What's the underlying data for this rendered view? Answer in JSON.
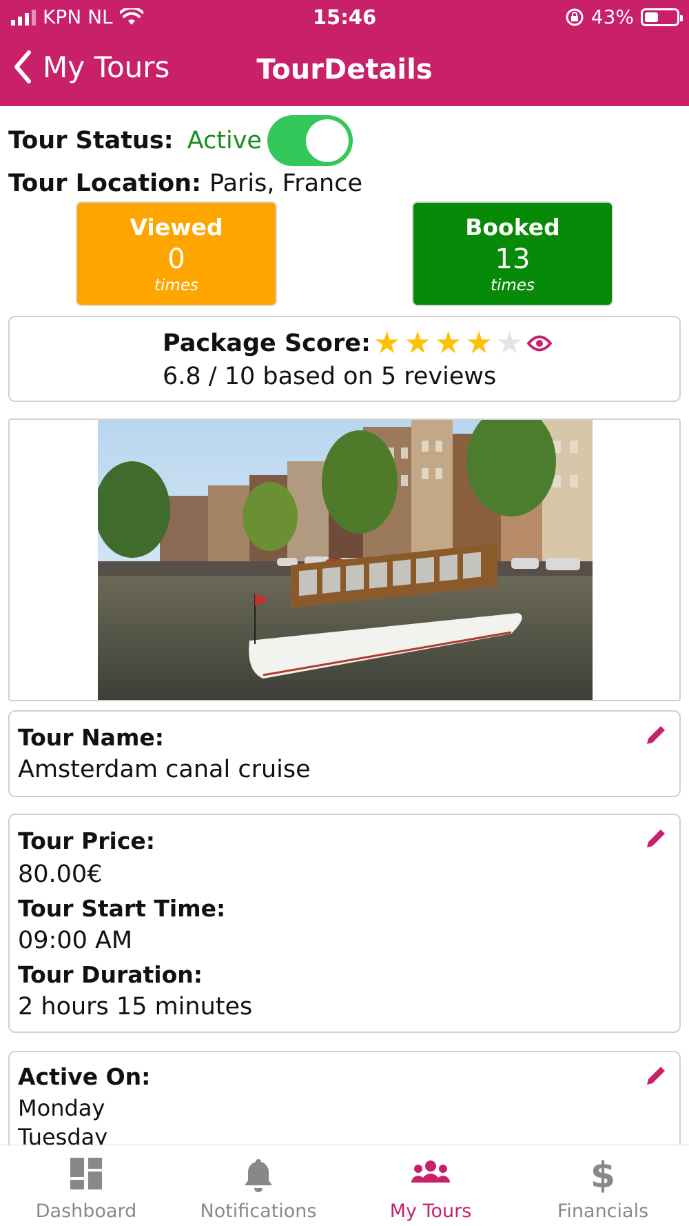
{
  "status_bar": {
    "carrier": "KPN NL",
    "time": "15:46",
    "battery": "43%",
    "battery_level": 0.43
  },
  "nav": {
    "back_label": "My Tours",
    "title": "TourDetails"
  },
  "tour_status": {
    "label": "Tour Status:",
    "value": "Active",
    "enabled": true
  },
  "tour_location": {
    "label": "Tour Location:",
    "value": "Paris, France"
  },
  "stats": {
    "viewed": {
      "title": "Viewed",
      "count": "0",
      "unit": "times",
      "color": "#ffa500"
    },
    "booked": {
      "title": "Booked",
      "count": "13",
      "unit": "times",
      "color": "#078a07"
    }
  },
  "package_score": {
    "label": "Package Score:",
    "stars_filled": 4,
    "stars_total": 5,
    "summary": "6.8 / 10 based on 5 reviews"
  },
  "tour_image": {
    "description_icon": "canal-boat-photo"
  },
  "tour_name": {
    "label": "Tour Name:",
    "value": "Amsterdam canal cruise"
  },
  "tour_details": {
    "price_label": "Tour Price:",
    "price_value": "80.00€",
    "start_label": "Tour Start Time:",
    "start_value": "09:00 AM",
    "duration_label": "Tour Duration:",
    "duration_value": "2 hours 15 minutes"
  },
  "active_on": {
    "label": "Active On:",
    "days": [
      "Monday",
      "Tuesday"
    ]
  },
  "tabbar": {
    "items": [
      {
        "label": "Dashboard",
        "icon": "dashboard-icon"
      },
      {
        "label": "Notifications",
        "icon": "bell-icon"
      },
      {
        "label": "My Tours",
        "icon": "users-icon"
      },
      {
        "label": "Financials",
        "icon": "dollar-icon"
      }
    ],
    "active_index": 2
  },
  "colors": {
    "brand": "#c8216a",
    "active_green": "#1a8a1a",
    "toggle_on": "#34c759",
    "inactive_tab": "#888888"
  }
}
